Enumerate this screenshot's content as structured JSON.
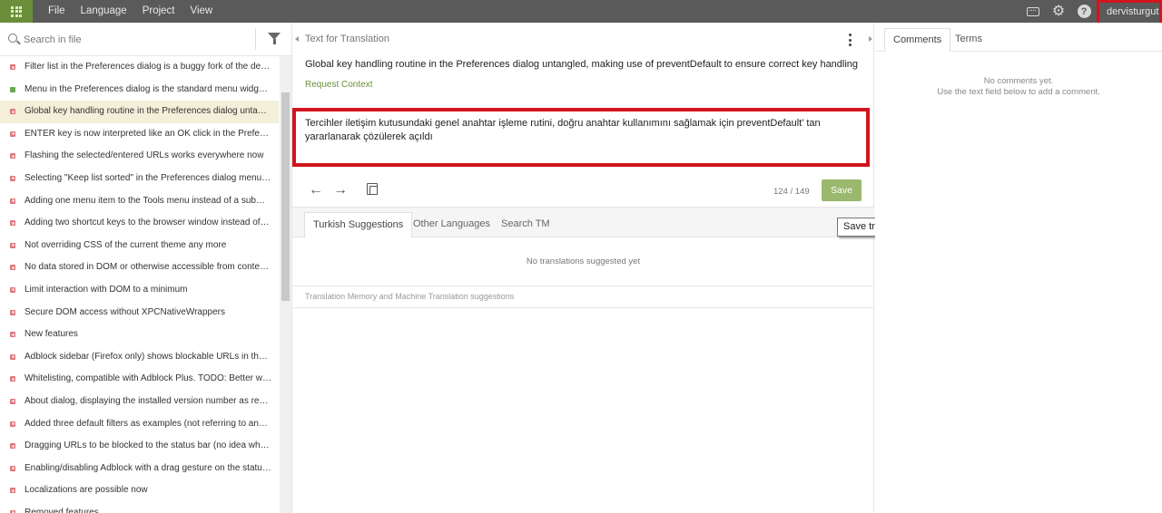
{
  "topbar": {
    "menu": [
      "File",
      "Language",
      "Project",
      "View"
    ],
    "username": "dervisturgut",
    "icons": [
      "apps-grid-icon",
      "keyboard-icon",
      "settings-gear-icon",
      "help-icon"
    ]
  },
  "left": {
    "search_placeholder": "Search in file",
    "items": [
      {
        "text": "Filter list in the Preferences dialog is a buggy fork of the defa...",
        "status": "untranslated"
      },
      {
        "text": "Menu in the Preferences dialog is the standard menu widget ...",
        "status": "translated"
      },
      {
        "text": "Global key handling routine in the Preferences dialog untangl...",
        "status": "untranslated"
      },
      {
        "text": "ENTER key is now interpreted like an OK click in the Preferenc...",
        "status": "untranslated"
      },
      {
        "text": "Flashing the selected/entered URLs works everywhere now",
        "status": "untranslated"
      },
      {
        "text": "Selecting \"Keep list sorted\" in the Preferences dialog menu a...",
        "status": "untranslated"
      },
      {
        "text": "Adding one menu item to the Tools menu instead of a subme...",
        "status": "untranslated"
      },
      {
        "text": "Adding two shortcut keys to the browser window instead of fi...",
        "status": "untranslated"
      },
      {
        "text": "Not overriding CSS of the current theme any more",
        "status": "untranslated"
      },
      {
        "text": "No data stored in DOM or otherwise accessible from content ...",
        "status": "untranslated"
      },
      {
        "text": "Limit interaction with DOM to a minimum",
        "status": "untranslated"
      },
      {
        "text": "Secure DOM access without XPCNativeWrappers",
        "status": "untranslated"
      },
      {
        "text": "New features",
        "status": "untranslated"
      },
      {
        "text": "Adblock sidebar (Firefox only) shows blockable URLs in the cu...",
        "status": "untranslated"
      },
      {
        "text": "Whitelisting, compatible with Adblock Plus. TODO: Better whit...",
        "status": "untranslated"
      },
      {
        "text": "About dialog, displaying the installed version number as repo...",
        "status": "untranslated"
      },
      {
        "text": "Added three default filters as examples (not referring to any s...",
        "status": "untranslated"
      },
      {
        "text": "Dragging URLs to be blocked to the status bar (no idea what t...",
        "status": "untranslated"
      },
      {
        "text": "Enabling/disabling Adblock with a drag gesture on the status ...",
        "status": "untranslated"
      },
      {
        "text": "Localizations are possible now",
        "status": "untranslated"
      },
      {
        "text": "Removed features",
        "status": "untranslated"
      }
    ],
    "active_index": 2,
    "colors": {
      "untranslated": "#e0767c",
      "translated": "#6bab50",
      "active_bg": "#f3efd9"
    }
  },
  "center": {
    "section_label": "Text for Translation",
    "source_text": "Global key handling routine in the Preferences dialog untangled, making use of preventDefault to ensure correct key handling",
    "request_context": "Request Context",
    "translation": "Tercihler iletişim kutusundaki genel anahtar işleme rutini, doğru anahtar kullanımını sağlamak için preventDefault' tan yararlanarak çözülerek açıldı",
    "counter": "124 / 149",
    "save_label": "Save",
    "tabs": [
      "Turkish Suggestions",
      "Other Languages",
      "Search TM"
    ],
    "no_suggestions": "No translations suggested yet",
    "tm_label": "Translation Memory and Machine Translation suggestions",
    "tooltip": "Save translation (Ctrl+Enter)",
    "colors": {
      "accent": "#9ab86e",
      "highlight": "#d2141c"
    }
  },
  "right": {
    "tabs": [
      "Comments",
      "Terms"
    ],
    "no_comments_line1": "No comments yet.",
    "no_comments_line2": "Use the text field below to add a comment."
  }
}
